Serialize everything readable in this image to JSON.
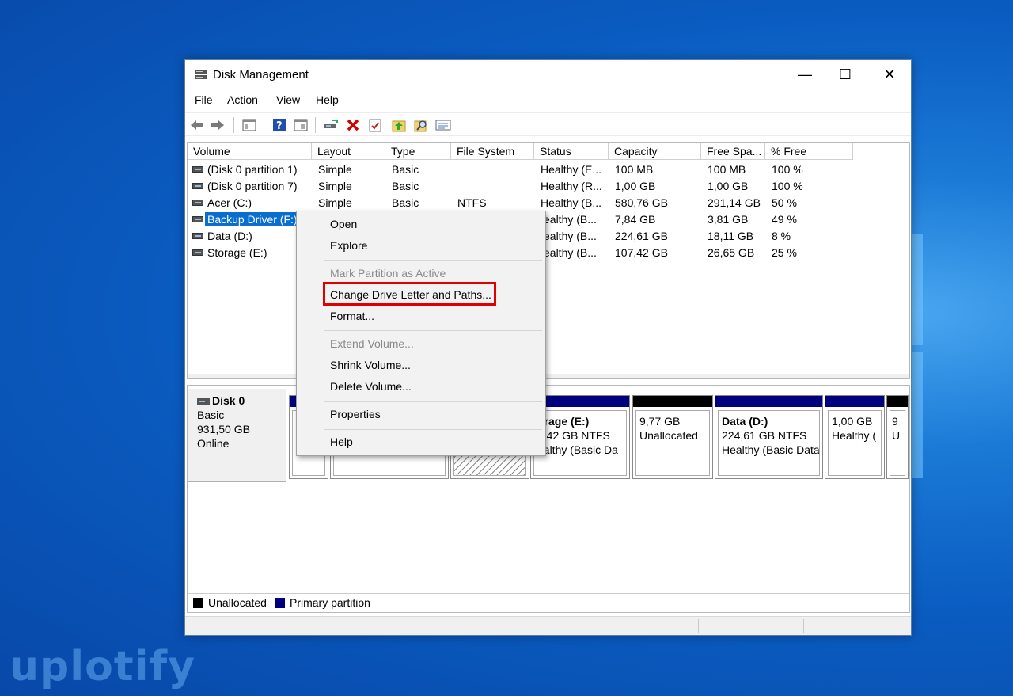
{
  "watermark": "uplotify",
  "window": {
    "title": "Disk Management",
    "minimize_glyph": "—",
    "maximize_glyph": "☐",
    "close_glyph": "✕"
  },
  "menu": [
    "File",
    "Action",
    "View",
    "Help"
  ],
  "toolbar": {
    "icons": [
      "back-icon",
      "forward-icon",
      "console-tree-icon",
      "help-icon",
      "console-icon",
      "connect-icon",
      "delete-icon",
      "properties-icon",
      "up-icon",
      "search-icon",
      "list-icon"
    ]
  },
  "columns": [
    "Volume",
    "Layout",
    "Type",
    "File System",
    "Status",
    "Capacity",
    "Free Spa...",
    "% Free"
  ],
  "rows": [
    {
      "volume": "(Disk 0 partition 1)",
      "layout": "Simple",
      "type": "Basic",
      "fs": "",
      "status": "Healthy (E...",
      "capacity": "100 MB",
      "free": "100 MB",
      "pct": "100 %"
    },
    {
      "volume": "(Disk 0 partition 7)",
      "layout": "Simple",
      "type": "Basic",
      "fs": "",
      "status": "Healthy (R...",
      "capacity": "1,00 GB",
      "free": "1,00 GB",
      "pct": "100 %"
    },
    {
      "volume": "Acer (C:)",
      "layout": "Simple",
      "type": "Basic",
      "fs": "NTFS",
      "status": "Healthy (B...",
      "capacity": "580,76 GB",
      "free": "291,14 GB",
      "pct": "50 %"
    },
    {
      "volume": "Backup Driver (F:)",
      "layout": "",
      "type": "",
      "fs": "",
      "status": "ealthy (B...",
      "capacity": "7,84 GB",
      "free": "3,81 GB",
      "pct": "49 %"
    },
    {
      "volume": "Data (D:)",
      "layout": "",
      "type": "",
      "fs": "",
      "status": "ealthy (B...",
      "capacity": "224,61 GB",
      "free": "18,11 GB",
      "pct": "8 %"
    },
    {
      "volume": "Storage (E:)",
      "layout": "",
      "type": "",
      "fs": "",
      "status": "ealthy (B...",
      "capacity": "107,42 GB",
      "free": "26,65 GB",
      "pct": "25 %"
    }
  ],
  "disk": {
    "name": "Disk 0",
    "type": "Basic",
    "size": "931,50 GB",
    "state": "Online"
  },
  "partitions": [
    {
      "title": "orage  (E:)",
      "line2": "7,42 GB NTFS",
      "line3": "ealthy (Basic Da",
      "bar_color": "#00007f"
    },
    {
      "title": "",
      "line2": "9,77 GB",
      "line3": "Unallocated",
      "bar_color": "#000000"
    },
    {
      "title": "Data  (D:)",
      "line2": "224,61 GB NTFS",
      "line3": "Healthy (Basic Data",
      "bar_color": "#00007f"
    },
    {
      "title": "",
      "line2": "1,00 GB",
      "line3": "Healthy (",
      "bar_color": "#00007f"
    },
    {
      "title": "",
      "line2": "9",
      "line3": "U",
      "bar_color": "#000000"
    }
  ],
  "legend": [
    {
      "label": "Unallocated",
      "color": "#000000"
    },
    {
      "label": "Primary partition",
      "color": "#00007f"
    }
  ],
  "context_menu": {
    "open": "Open",
    "explore": "Explore",
    "mark_active": "Mark Partition as Active",
    "change_letter": "Change Drive Letter and Paths...",
    "format": "Format...",
    "extend": "Extend Volume...",
    "shrink": "Shrink Volume...",
    "delete": "Delete Volume...",
    "properties": "Properties",
    "help": "Help"
  }
}
